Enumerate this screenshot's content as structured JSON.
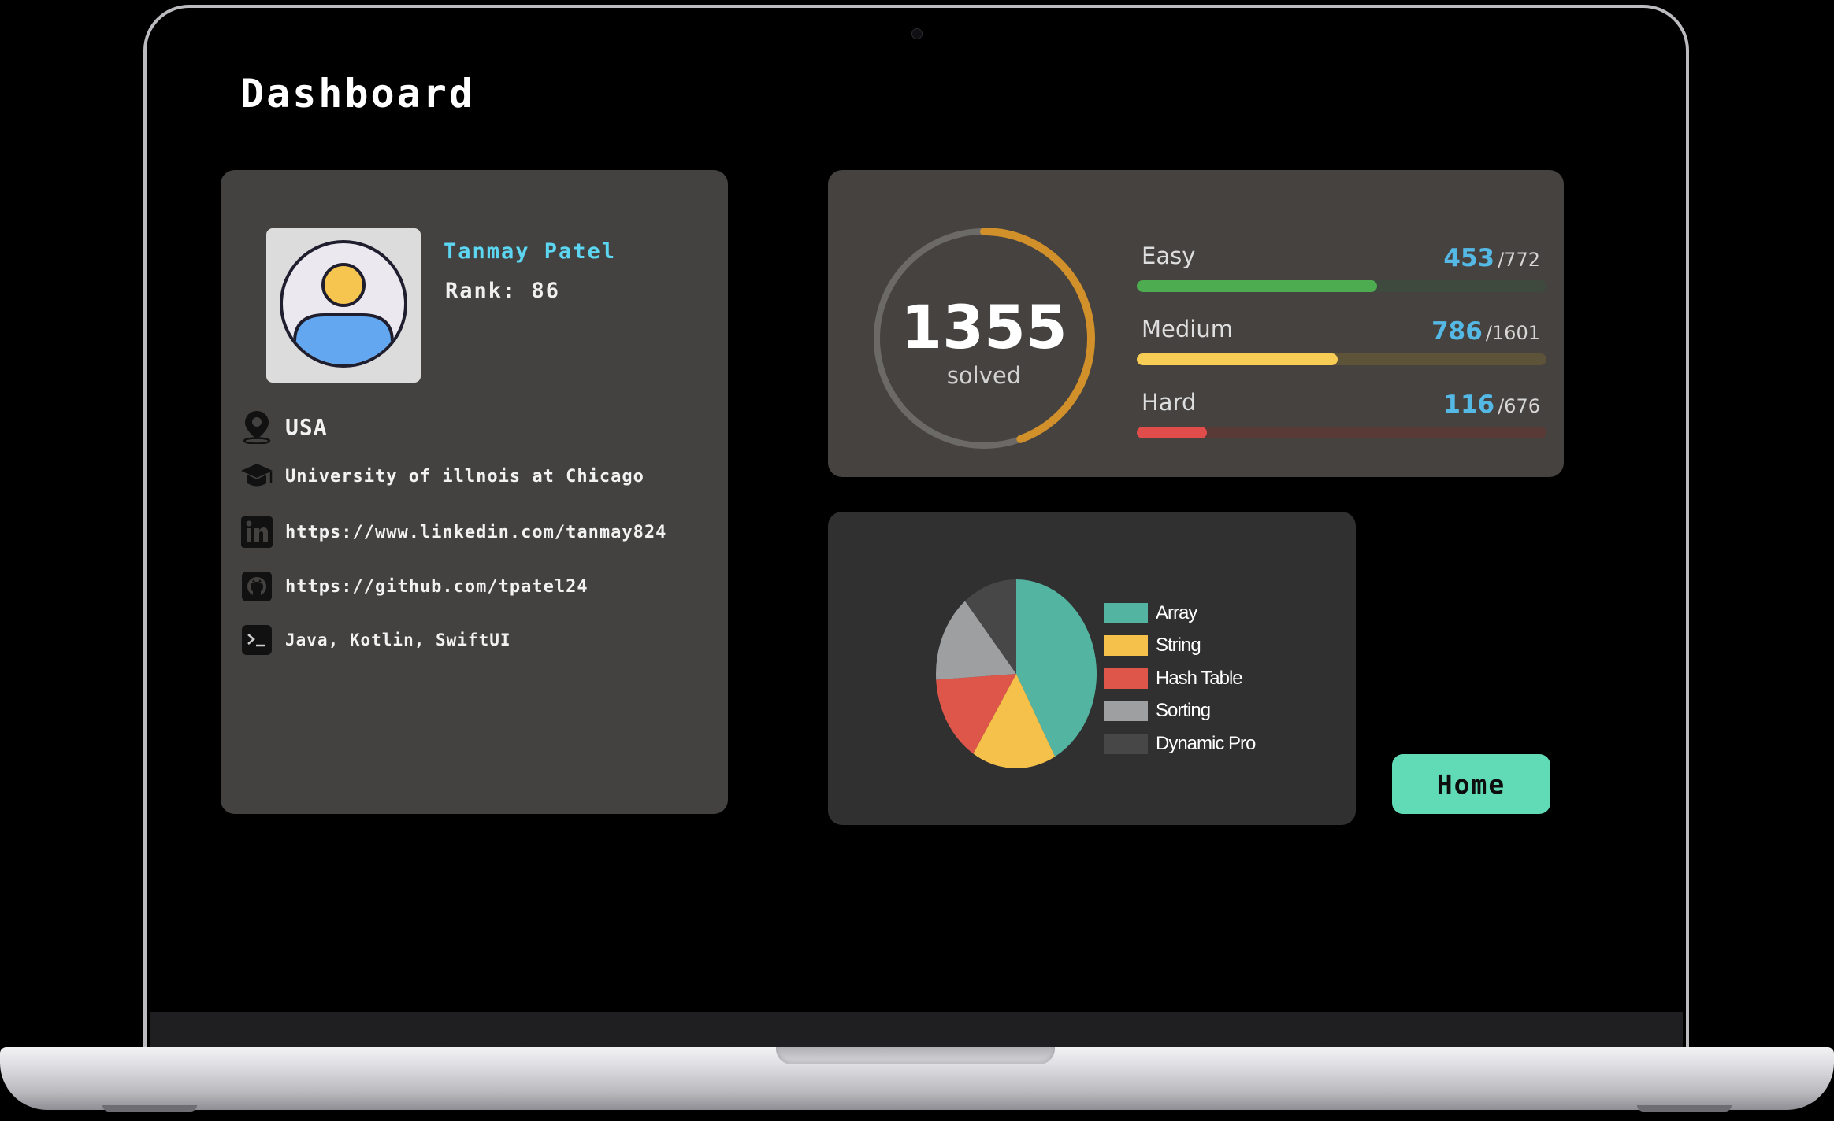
{
  "page_title": "Dashboard",
  "profile": {
    "name": "Tanmay Patel",
    "rank": "Rank: 86",
    "location": "USA",
    "school": "University of illnois at Chicago",
    "linkedin": "https://www.linkedin.com/tanmay824",
    "github": "https://github.com/tpatel24",
    "skills": "Java, Kotlin, SwiftUI",
    "icons": [
      "avatar-icon",
      "location-pin-icon",
      "graduation-cap-icon",
      "linkedin-icon",
      "github-icon",
      "terminal-icon"
    ]
  },
  "stats": {
    "total_solved": "1355",
    "solved_label": "solved",
    "difficulties": [
      {
        "name": "Easy",
        "solved": "453",
        "total": "/772",
        "color": "#4dac4f",
        "track_color": "#3e4a3d"
      },
      {
        "name": "Medium",
        "solved": "786",
        "total": "/1601",
        "color": "#f7cd55",
        "track_color": "#5c5338"
      },
      {
        "name": "Hard",
        "solved": "116",
        "total": "/676",
        "color": "#e04d4a",
        "track_color": "#5a3a37"
      }
    ],
    "ring_colors": {
      "progress": "#d2902a",
      "track": "#6c6a67"
    }
  },
  "chart_data": {
    "type": "pie",
    "categories": [
      "Array",
      "String",
      "Hash Table",
      "Sorting",
      "Dynamic Pro"
    ],
    "values": [
      42,
      17,
      15,
      15,
      11
    ],
    "colors": [
      "#53b4a1",
      "#f6c14a",
      "#de554a",
      "#9e9fa1",
      "#474747"
    ],
    "legend_position": "right"
  },
  "home_button": "Home",
  "accent_color": "#61dbb5"
}
